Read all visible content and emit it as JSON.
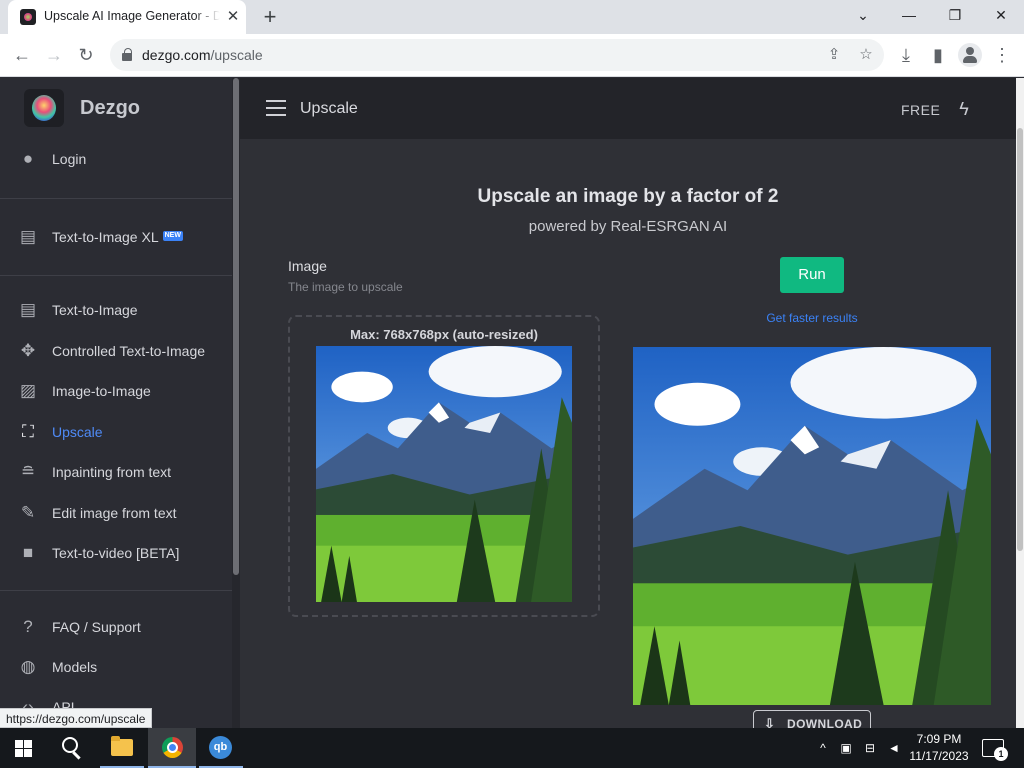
{
  "browser": {
    "tab_title": "Upscale AI Image Generator - Dezgo",
    "tab_close": "✕",
    "new_tab": "+",
    "window_controls": {
      "minimize": "—",
      "restore": "❐",
      "close": "✕",
      "tab_search": "⌄"
    },
    "url_host": "dezgo.com",
    "url_path": "/upscale",
    "status_url": "https://dezgo.com/upscale"
  },
  "sidebar": {
    "brand": "Dezgo",
    "login": {
      "label": "Login",
      "icon": "account-circle-icon"
    },
    "featured": [
      {
        "label": "Text-to-Image XL",
        "badge": "NEW",
        "icon": "message-dots-icon"
      }
    ],
    "tools": [
      {
        "label": "Text-to-Image",
        "icon": "message-dots-icon"
      },
      {
        "label": "Controlled Text-to-Image",
        "icon": "move-icon"
      },
      {
        "label": "Image-to-Image",
        "icon": "image-icon"
      },
      {
        "label": "Upscale",
        "icon": "aspect-ratio-icon",
        "active": true
      },
      {
        "label": "Inpainting from text",
        "icon": "wrap-text-icon"
      },
      {
        "label": "Edit image from text",
        "icon": "edit-note-icon"
      },
      {
        "label": "Text-to-video [BETA]",
        "icon": "videocam-icon"
      }
    ],
    "support": [
      {
        "label": "FAQ / Support",
        "icon": "help-icon"
      },
      {
        "label": "Models",
        "icon": "models-icon"
      },
      {
        "label": "API",
        "icon": "code-icon"
      }
    ]
  },
  "header": {
    "title": "Upscale",
    "plan": "FREE"
  },
  "main": {
    "headline": "Upscale an image by a factor of 2",
    "subheadline": "powered by Real-ESRGAN AI",
    "image_field": {
      "label": "Image",
      "hint": "The image to upscale",
      "dropzone_hint": "Max: 768x768px (auto-resized)"
    },
    "run_label": "Run",
    "faster_link": "Get faster results",
    "download_label": "DOWNLOAD"
  },
  "taskbar": {
    "qb_label": "qb",
    "time": "7:09 PM",
    "date": "11/17/2023",
    "notification_count": "1"
  },
  "colors": {
    "accent_link": "#3b82f6",
    "run_button": "#10b981",
    "sidebar_bg": "#2b2c33",
    "content_bg": "#2f3036"
  }
}
